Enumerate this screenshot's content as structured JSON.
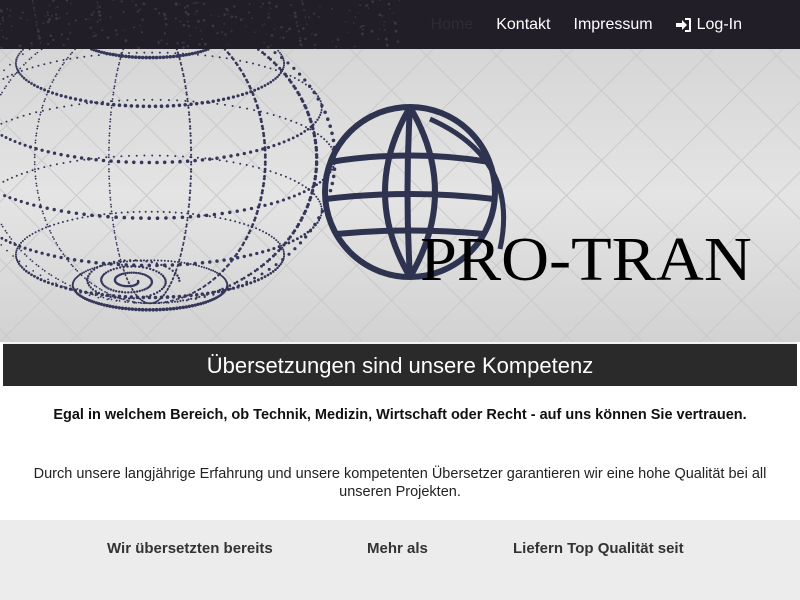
{
  "nav": {
    "items": [
      {
        "label": "Home",
        "active": true
      },
      {
        "label": "Kontakt"
      },
      {
        "label": "Impressum"
      },
      {
        "label": "Log-In",
        "icon": "sign-in-icon"
      }
    ]
  },
  "hero": {
    "logo_text": "PRO-TRAN",
    "globe_icon": "globe-icon",
    "colors": {
      "globe": "#2e3350",
      "dots": "#34365a",
      "background": "#dcdcdc"
    }
  },
  "tagline": "Übersetzungen sind unsere Kompetenz",
  "intro": {
    "headline": "Egal in welchem Bereich, ob Technik, Medizin, Wirtschaft oder Recht - auf uns können Sie vertrauen.",
    "body": "Durch unsere langjährige Erfahrung und unsere kompetenten Übersetzer garantieren wir eine hohe Qualität bei all unseren Projekten."
  },
  "stats": {
    "labels": [
      "Wir übersetzten bereits",
      "Mehr als",
      "Liefern Top Qualität seit"
    ]
  }
}
